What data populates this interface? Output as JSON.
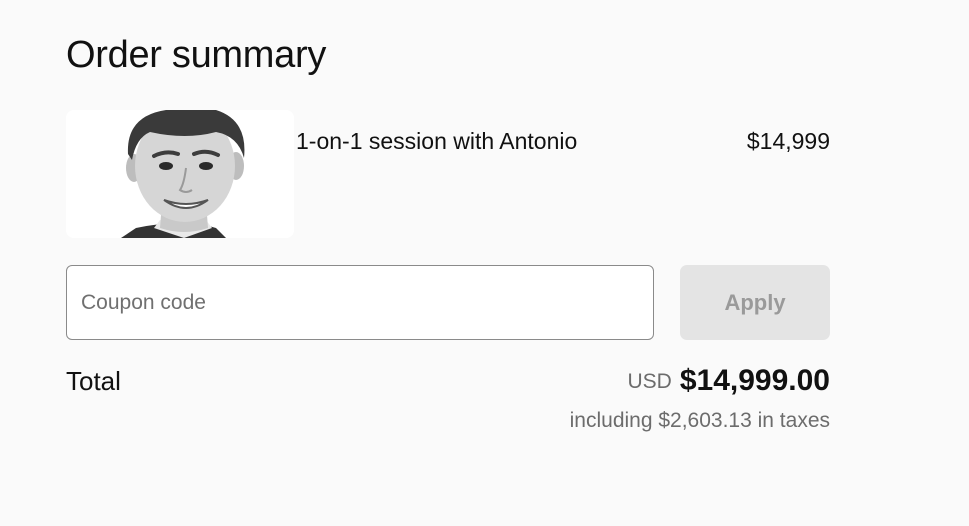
{
  "order_summary": {
    "title": "Order summary"
  },
  "item": {
    "name": "1-on-1 session with Antonio",
    "price": "$14,999",
    "image": "person-portrait-photo"
  },
  "coupon": {
    "placeholder": "Coupon code",
    "value": "",
    "apply_label": "Apply"
  },
  "total": {
    "label": "Total",
    "currency": "USD",
    "amount": "$14,999.00",
    "tax_note": "including $2,603.13 in taxes"
  }
}
